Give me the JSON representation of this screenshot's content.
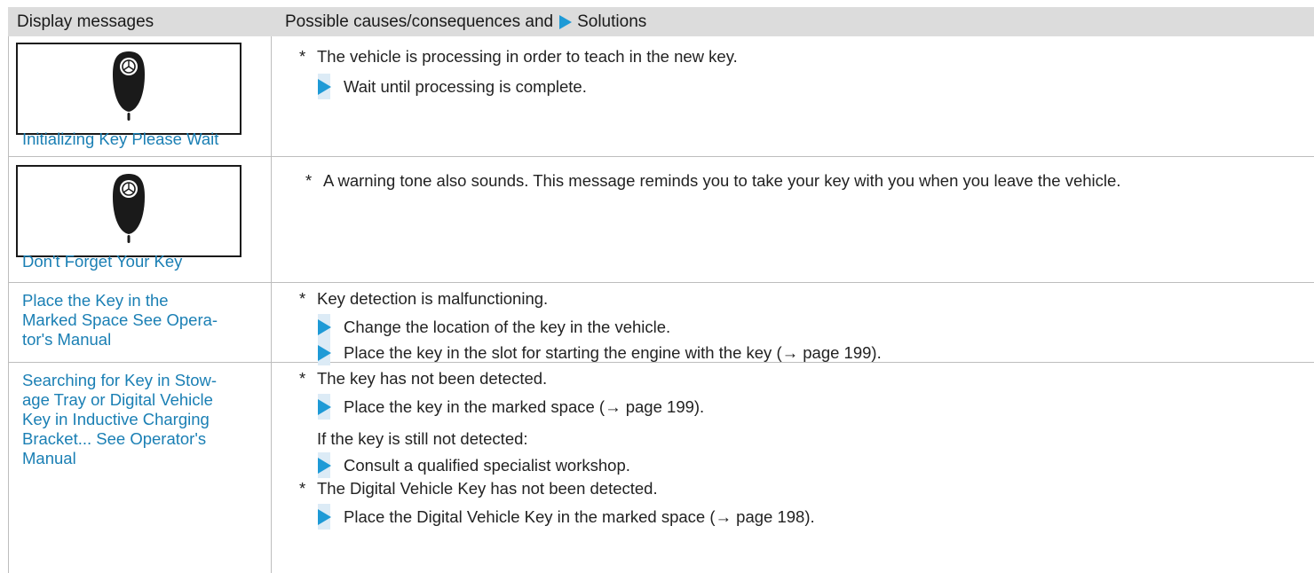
{
  "header": {
    "col1": "Display messages",
    "col2_prefix": "Possible causes/consequences and",
    "col2_suffix": "Solutions"
  },
  "rows": [
    {
      "message": "Initializing Key Please Wait",
      "icon": "key-fob-icon",
      "items": [
        {
          "bullet": "*",
          "text": "The vehicle is processing in order to teach in the new key."
        },
        {
          "step": "Wait until processing is complete."
        }
      ]
    },
    {
      "message": "Don't Forget Your Key",
      "icon": "key-fob-icon",
      "items": [
        {
          "bullet": "*",
          "text": "A warning tone also sounds. This message reminds you to take your key with you when you leave the vehicle."
        }
      ]
    },
    {
      "message_lines": [
        "Place the Key in the",
        "Marked Space See Opera-",
        "tor's Manual"
      ],
      "items": [
        {
          "bullet": "*",
          "text": "Key detection is malfunctioning."
        },
        {
          "step": "Change the location of the key in the vehicle."
        },
        {
          "step": "Place the key in the slot for starting the engine with the key (→ page 199)."
        }
      ]
    },
    {
      "message_lines": [
        "Searching for Key in Stow-",
        "age Tray or Digital Vehicle",
        "Key in Inductive Charging",
        "Bracket... See Operator's",
        "Manual"
      ],
      "items": [
        {
          "bullet": "*",
          "text": "The key has not been detected."
        },
        {
          "step": "Place the key in the marked space (→ page 199)."
        },
        {
          "text": "If the key is still not detected:"
        },
        {
          "step": "Consult a qualified specialist workshop."
        },
        {
          "bullet": "*",
          "text": "The Digital Vehicle Key has not been detected."
        },
        {
          "step": "Place the Digital Vehicle Key in the marked space (→ page 198)."
        }
      ]
    }
  ],
  "colors": {
    "header_bg": "#dcdcdc",
    "link": "#1a7fb4",
    "accent": "#1e9ad6",
    "step_bar": "#dcebf6"
  }
}
